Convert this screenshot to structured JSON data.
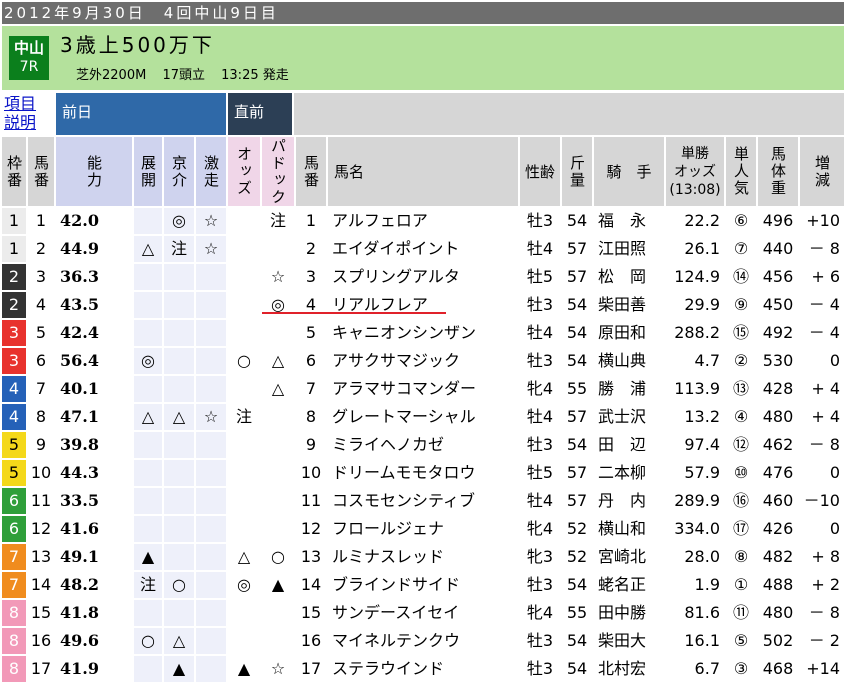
{
  "header": {
    "date_line": "2012年9月30日　4回中山9日目",
    "course": "中山",
    "race_no": "7R",
    "title": "3歳上500万下",
    "surface": "芝外2200M",
    "runners": "17頭立",
    "post_time": "13:25 発走"
  },
  "help_link": "項目\n説明",
  "sections": {
    "prev_day": "前日",
    "direct": "直前"
  },
  "columns": {
    "waku": "枠番",
    "uma": "馬番",
    "ability": "能力",
    "tenkai": "展開",
    "kyosuke": "京介",
    "gekiso": "激走",
    "odds": "オッズ",
    "paddock": "パドック",
    "uma2": "馬番",
    "name": "馬名",
    "sexage": "性齢",
    "kinryo": "斤量",
    "jockey": "騎　手",
    "tan_odds": "単勝\nオッズ\n(13:08)",
    "ninki": "単人気",
    "weight": "馬体重",
    "diff": "増減"
  },
  "colors": {
    "waku_1": "#ececec",
    "waku_2": "#333333",
    "waku_3": "#e8322d",
    "waku_4": "#2561b8",
    "waku_5": "#f4d81a",
    "waku_6": "#2f9f3a",
    "waku_7": "#f08c1e",
    "waku_8": "#f299b8",
    "marker_line": "#e0212a"
  },
  "rows": [
    {
      "waku": "1",
      "uma": "1",
      "ability": "42.0",
      "tenkai": "",
      "kyosuke": "",
      "gekiso_a": "◎",
      "gekiso": "☆",
      "odds": "",
      "paddock": "注",
      "name": "アルフェロア",
      "sexage": "牡3",
      "kinryo": "54",
      "jockey": "福　永",
      "tan": "22.2",
      "ninki": "⑥",
      "weight": "496",
      "diff": "+10"
    },
    {
      "waku": "1",
      "uma": "2",
      "ability": "44.9",
      "tenkai": "△",
      "kyosuke": "△",
      "gekiso_a": "注",
      "gekiso": "☆",
      "odds": "",
      "paddock": "",
      "name": "エイダイポイント",
      "sexage": "牡4",
      "kinryo": "57",
      "jockey": "江田照",
      "tan": "26.1",
      "ninki": "⑦",
      "weight": "440",
      "diff": "－ 8"
    },
    {
      "waku": "2",
      "uma": "3",
      "ability": "36.3",
      "tenkai": "",
      "kyosuke": "",
      "gekiso_a": "",
      "gekiso": "",
      "odds": "",
      "paddock": "☆",
      "name": "スプリングアルタ",
      "sexage": "牡5",
      "kinryo": "57",
      "jockey": "松　岡",
      "tan": "124.9",
      "ninki": "⑭",
      "weight": "456",
      "diff": "+ 6"
    },
    {
      "waku": "2",
      "uma": "4",
      "ability": "43.5",
      "tenkai": "",
      "kyosuke": "",
      "gekiso_a": "",
      "gekiso": "",
      "odds": "",
      "paddock": "◎",
      "name": "リアルフレア",
      "sexage": "牡3",
      "kinryo": "54",
      "jockey": "柴田善",
      "tan": "29.9",
      "ninki": "⑨",
      "weight": "450",
      "diff": "－ 4"
    },
    {
      "waku": "3",
      "uma": "5",
      "ability": "42.4",
      "tenkai": "",
      "kyosuke": "",
      "gekiso_a": "",
      "gekiso": "",
      "odds": "",
      "paddock": "",
      "name": "キャニオンシンザン",
      "sexage": "牡4",
      "kinryo": "54",
      "jockey": "原田和",
      "tan": "288.2",
      "ninki": "⑮",
      "weight": "492",
      "diff": "－ 4"
    },
    {
      "waku": "3",
      "uma": "6",
      "ability": "56.4",
      "tenkai": "◎",
      "kyosuke": "◎",
      "gekiso_a": "",
      "gekiso": "",
      "odds": "○",
      "paddock": "△",
      "name": "アサクサマジック",
      "sexage": "牡3",
      "kinryo": "54",
      "jockey": "横山典",
      "tan": "4.7",
      "ninki": "②",
      "weight": "530",
      "diff": "0"
    },
    {
      "waku": "4",
      "uma": "7",
      "ability": "40.1",
      "tenkai": "",
      "kyosuke": "",
      "gekiso_a": "",
      "gekiso": "",
      "odds": "",
      "paddock": "△",
      "name": "アラマサコマンダー",
      "sexage": "牝4",
      "kinryo": "55",
      "jockey": "勝　浦",
      "tan": "113.9",
      "ninki": "⑬",
      "weight": "428",
      "diff": "+ 4"
    },
    {
      "waku": "4",
      "uma": "8",
      "ability": "47.1",
      "tenkai": "△",
      "kyosuke": "▲",
      "gekiso_a": "△",
      "gekiso": "☆",
      "odds": "注",
      "paddock": "",
      "name": "グレートマーシャル",
      "sexage": "牡4",
      "kinryo": "57",
      "jockey": "武士沢",
      "tan": "13.2",
      "ninki": "④",
      "weight": "480",
      "diff": "+ 4"
    },
    {
      "waku": "5",
      "uma": "9",
      "ability": "39.8",
      "tenkai": "",
      "kyosuke": "",
      "gekiso_a": "",
      "gekiso": "",
      "odds": "",
      "paddock": "",
      "name": "ミライヘノカゼ",
      "sexage": "牡3",
      "kinryo": "54",
      "jockey": "田　辺",
      "tan": "97.4",
      "ninki": "⑫",
      "weight": "462",
      "diff": "－ 8"
    },
    {
      "waku": "5",
      "uma": "10",
      "ability": "44.3",
      "tenkai": "",
      "kyosuke": "",
      "gekiso_a": "",
      "gekiso": "",
      "odds": "",
      "paddock": "",
      "name": "ドリームモモタロウ",
      "sexage": "牡5",
      "kinryo": "57",
      "jockey": "二本柳",
      "tan": "57.9",
      "ninki": "⑩",
      "weight": "476",
      "diff": "0"
    },
    {
      "waku": "6",
      "uma": "11",
      "ability": "33.5",
      "tenkai": "",
      "kyosuke": "",
      "gekiso_a": "",
      "gekiso": "",
      "odds": "",
      "paddock": "",
      "name": "コスモセンシティブ",
      "sexage": "牡4",
      "kinryo": "57",
      "jockey": "丹　内",
      "tan": "289.9",
      "ninki": "⑯",
      "weight": "460",
      "diff": "－10"
    },
    {
      "waku": "6",
      "uma": "12",
      "ability": "41.6",
      "tenkai": "",
      "kyosuke": "",
      "gekiso_a": "",
      "gekiso": "",
      "odds": "",
      "paddock": "",
      "name": "フロールジェナ",
      "sexage": "牝4",
      "kinryo": "52",
      "jockey": "横山和",
      "tan": "334.0",
      "ninki": "⑰",
      "weight": "426",
      "diff": "0"
    },
    {
      "waku": "7",
      "uma": "13",
      "ability": "49.1",
      "tenkai": "▲",
      "kyosuke": "",
      "gekiso_a": "",
      "gekiso": "",
      "odds": "△",
      "paddock": "○",
      "name": "ルミナスレッド",
      "sexage": "牝3",
      "kinryo": "52",
      "jockey": "宮崎北",
      "tan": "28.0",
      "ninki": "⑧",
      "weight": "482",
      "diff": "+ 8"
    },
    {
      "waku": "7",
      "uma": "14",
      "ability": "48.2",
      "tenkai": "注",
      "kyosuke": "注",
      "gekiso_a": "○",
      "gekiso": "",
      "odds": "◎",
      "paddock": "▲",
      "name": "ブラインドサイド",
      "sexage": "牡3",
      "kinryo": "54",
      "jockey": "蛯名正",
      "tan": "1.9",
      "ninki": "①",
      "weight": "488",
      "diff": "+ 2"
    },
    {
      "waku": "8",
      "uma": "15",
      "ability": "41.8",
      "tenkai": "",
      "kyosuke": "",
      "gekiso_a": "",
      "gekiso": "",
      "odds": "",
      "paddock": "",
      "name": "サンデースイセイ",
      "sexage": "牝4",
      "kinryo": "55",
      "jockey": "田中勝",
      "tan": "81.6",
      "ninki": "⑪",
      "weight": "480",
      "diff": "－ 8"
    },
    {
      "waku": "8",
      "uma": "16",
      "ability": "49.6",
      "tenkai": "○",
      "kyosuke": "△",
      "gekiso_a": "△",
      "gekiso": "",
      "odds": "",
      "paddock": "",
      "name": "マイネルテンクウ",
      "sexage": "牡3",
      "kinryo": "54",
      "jockey": "柴田大",
      "tan": "16.1",
      "ninki": "⑤",
      "weight": "502",
      "diff": "－ 2"
    },
    {
      "waku": "8",
      "uma": "17",
      "ability": "41.9",
      "tenkai": "",
      "kyosuke": "○",
      "gekiso_a": "▲",
      "gekiso": "",
      "odds": "▲",
      "paddock": "☆",
      "name": "ステラウインド",
      "sexage": "牡3",
      "kinryo": "54",
      "jockey": "北村宏",
      "tan": "6.7",
      "ninki": "③",
      "weight": "468",
      "diff": "+14"
    }
  ]
}
